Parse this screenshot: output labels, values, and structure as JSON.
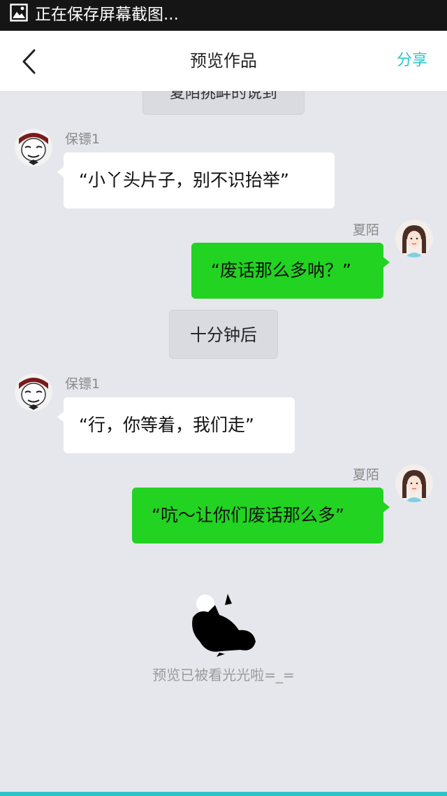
{
  "status_bar": {
    "text": "正在保存屏幕截图...",
    "icon": "image-icon"
  },
  "header": {
    "back_icon": "chevron-left-icon",
    "title": "预览作品",
    "share_label": "分享"
  },
  "chat": {
    "top_cut_text": "夏陌挑衅的说到",
    "time_divider": "十分钟后",
    "messages": [
      {
        "sender": "保镖1",
        "side": "left",
        "text": "“小丫头片子，别不识抬举”",
        "avatar": "cartoon-face-avatar"
      },
      {
        "sender": "夏陌",
        "side": "right",
        "text": "“废话那么多呐？”",
        "avatar": "girl-avatar"
      },
      {
        "sender": "保镖1",
        "side": "left",
        "text": "“行，你等着，我们走”",
        "avatar": "cartoon-face-avatar"
      },
      {
        "sender": "夏陌",
        "side": "right",
        "text": "“吭～让你们废话那么多”",
        "avatar": "girl-avatar"
      }
    ],
    "end_icon": "sleeping-cat-icon",
    "end_text": "预览已被看光光啦=_="
  },
  "colors": {
    "accent": "#2cc4c8",
    "right_bubble": "#22d321",
    "left_bubble": "#ffffff",
    "background": "#e6e7ec"
  }
}
